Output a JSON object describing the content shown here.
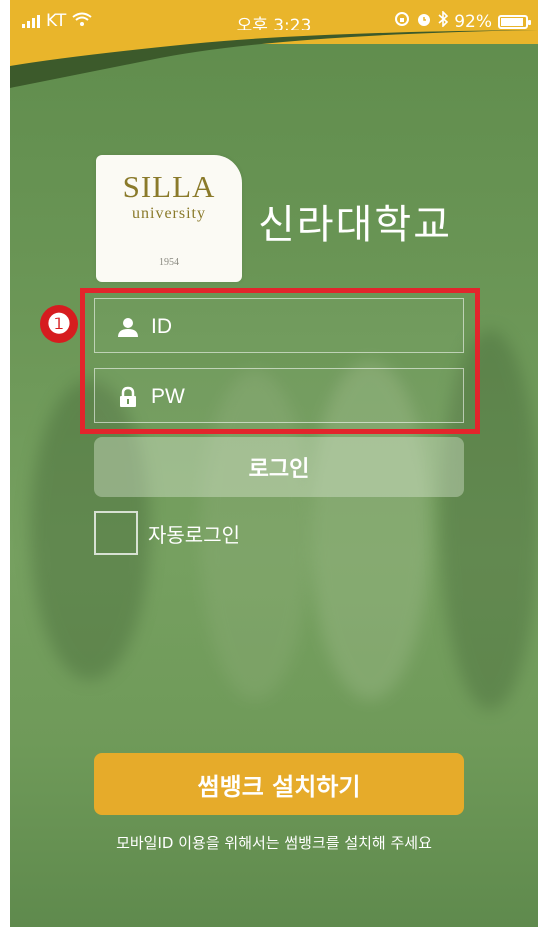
{
  "status_bar": {
    "carrier": "KT",
    "time": "오후 3:23",
    "battery": "92%"
  },
  "logo": {
    "line1": "SILLA",
    "line2": "university",
    "year": "1954"
  },
  "university_name": "신라대학교",
  "form": {
    "id_placeholder": "ID",
    "pw_placeholder": "PW",
    "login_label": "로그인",
    "auto_login_label": "자동로그인"
  },
  "annotation": {
    "marker": "❶",
    "color": "#e2252c"
  },
  "install": {
    "button_label": "썸뱅크 설치하기",
    "notice": "모바일ID 이용을 위해서는 썸뱅크를 설치해 주세요"
  },
  "colors": {
    "background": "#6c9757",
    "status_bar": "#e9b52b",
    "install_button": "#e6ab2a"
  }
}
